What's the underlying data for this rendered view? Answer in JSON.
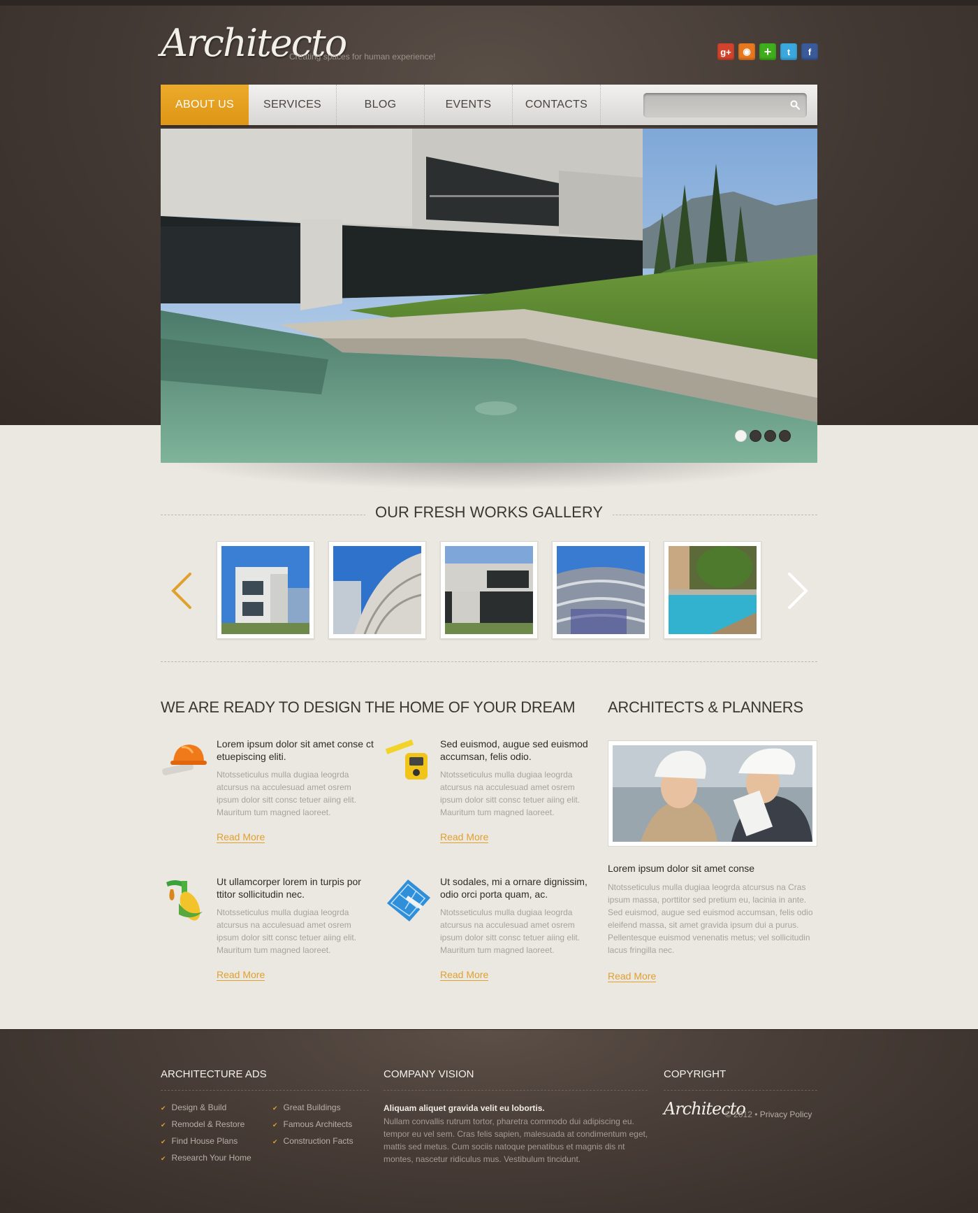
{
  "header": {
    "logo": "Architecto",
    "tagline": "Creating spaces for human experience!",
    "social": [
      {
        "icon": "google-plus-icon",
        "glyph": "g+",
        "color": "#d1432c"
      },
      {
        "icon": "rss-icon",
        "glyph": "◉",
        "color": "#e8781f"
      },
      {
        "icon": "add-icon",
        "glyph": "+",
        "color": "#3fae1d"
      },
      {
        "icon": "twitter-icon",
        "glyph": "t",
        "color": "#3ba8dd"
      },
      {
        "icon": "facebook-icon",
        "glyph": "f",
        "color": "#3b5a9a"
      }
    ]
  },
  "nav": {
    "items": [
      "About us",
      "Services",
      "Blog",
      "Events",
      "Contacts"
    ],
    "active_index": 0,
    "search_placeholder": ""
  },
  "slider": {
    "slide_count": 4,
    "active_slide": 1
  },
  "gallery": {
    "title": "Our Fresh Works Gallery",
    "thumb_count": 5
  },
  "features": {
    "title": "We are ready to design the home of your dream",
    "items": [
      {
        "icon": "hardhat-blueprint-icon",
        "heading": "Lorem ipsum dolor sit amet conse ct etuepiscing eliti.",
        "text": "Ntotsseticulus mulla dugiaa leogrda atcursus na acculesuad amet osrem ipsum dolor sitt consc tetuer aiing elit. Mauritum tum magned laoreet.",
        "link": "Read More"
      },
      {
        "icon": "tape-measure-icon",
        "heading": "Sed euismod, augue sed euismod accumsan, felis odio.",
        "text": "Ntotsseticulus mulla dugiaa leogrda atcursus na acculesuad amet osrem ipsum dolor sitt consc tetuer aiing elit. Mauritum tum magned laoreet.",
        "link": "Read More"
      },
      {
        "icon": "biofuel-corn-icon",
        "heading": "Ut ullamcorper lorem in turpis por ttitor sollicitudin nec.",
        "text": "Ntotsseticulus mulla dugiaa leogrda atcursus na acculesuad amet osrem ipsum dolor sitt consc tetuer aiing elit. Mauritum tum magned laoreet.",
        "link": "Read More"
      },
      {
        "icon": "blueprint-icon",
        "heading": "Ut sodales, mi a ornare dignissim, odio orci porta quam, ac.",
        "text": "Ntotsseticulus mulla dugiaa leogrda atcursus na acculesuad amet osrem ipsum dolor sitt consc tetuer aiing elit. Mauritum tum magned laoreet.",
        "link": "Read More"
      }
    ]
  },
  "architects": {
    "title": "Architects & Planners",
    "heading": "Lorem ipsum dolor sit amet conse",
    "text": "Ntotsseticulus mulla dugiaa leogrda atcursus na Cras ipsum massa, porttitor sed pretium eu, lacinia in ante. Sed euismod, augue sed euismod accumsan, felis odio eleifend massa, sit amet gravida ipsum dui a purus. Pellentesque euismod venenatis metus; vel sollicitudin lacus fringilla nec.",
    "link": "Read More"
  },
  "footer": {
    "ads_title": "Architecture Ads",
    "ads_col1": [
      "Design & Build",
      "Remodel & Restore",
      "Find House Plans",
      "Research Your Home"
    ],
    "ads_col2": [
      "Great Buildings",
      "Famous Architects",
      "Construction Facts"
    ],
    "vision_title": "Company Vision",
    "vision_bold": "Aliquam aliquet gravida velit eu lobortis.",
    "vision_text": "Nullam convallis rutrum tortor, pharetra commodo dui adipiscing eu. tempor eu vel sem. Cras felis sapien, malesuada at condimentum eget, mattis sed metus. Cum sociis natoque penatibus et magnis dis nt montes, nascetur ridiculus mus. Vestibulum tincidunt.",
    "copyright_title": "Copyright",
    "copyright_logo": "Architecto",
    "copyright_text": "© 2012 •",
    "privacy_link": "Privacy Policy"
  },
  "colors": {
    "accent": "#e0a02e",
    "dark_bg": "#423833",
    "paper_bg": "#ebe8e2"
  }
}
